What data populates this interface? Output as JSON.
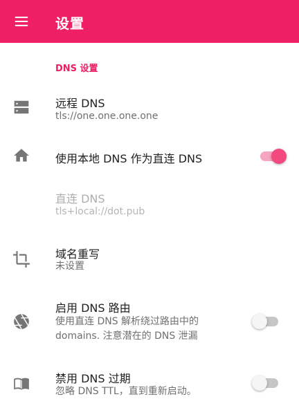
{
  "appbar": {
    "title": "设置"
  },
  "section": {
    "header": "DNS 设置"
  },
  "settings": [
    {
      "title": "远程 DNS",
      "summary": "tls://one.one.one.one",
      "icon": "server-icon",
      "enabled": true
    },
    {
      "title": "使用本地 DNS 作为直连 DNS",
      "icon": "home-icon",
      "switch_on": true
    },
    {
      "title": "直连 DNS",
      "summary": "tls+local://dot.pub",
      "enabled": false
    },
    {
      "title": "域名重写",
      "summary": "未设置",
      "icon": "crop-icon"
    },
    {
      "title": "启用 DNS 路由",
      "summary": "使用直连 DNS 解析绕过路由中的 domains. 注意潜在的 DNS 泄漏",
      "icon": "aperture-icon",
      "switch_on": false
    },
    {
      "title": "禁用 DNS 过期",
      "summary": "忽略 DNS TTL，直到重新启动。",
      "icon": "book-icon",
      "switch_on": false
    }
  ],
  "colors": {
    "primary": "#ef1f66",
    "accent": "#e91e63",
    "icon": "#757575"
  }
}
